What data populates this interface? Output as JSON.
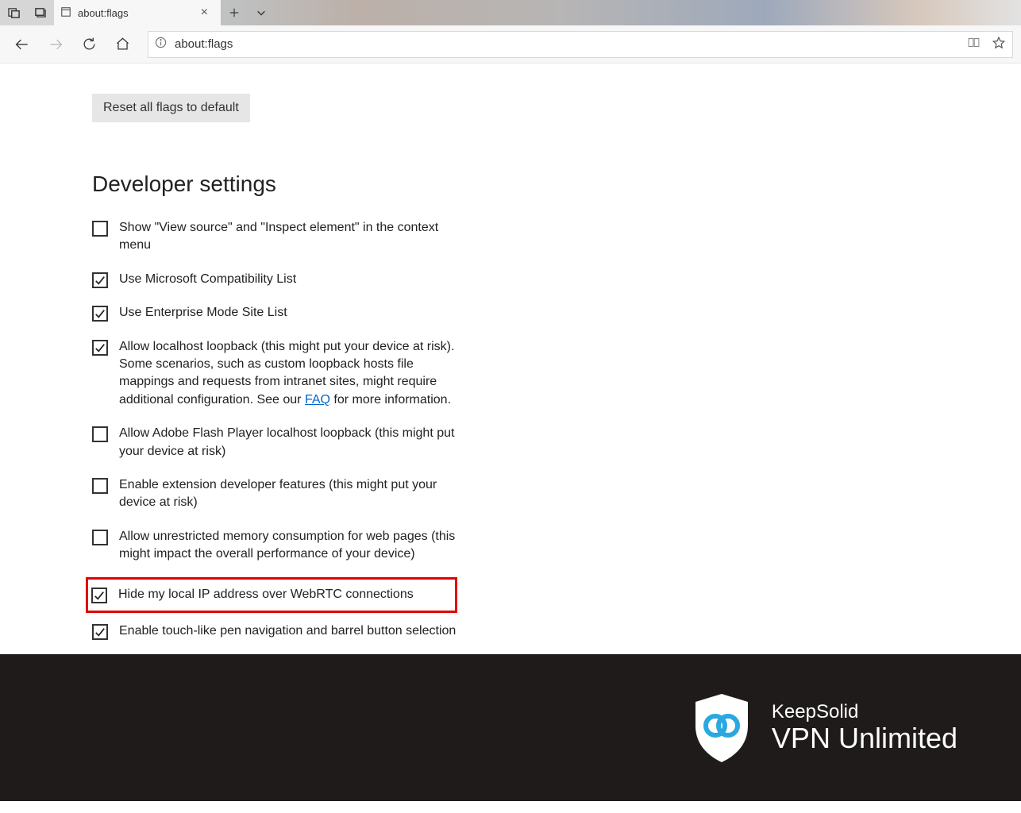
{
  "tab": {
    "title": "about:flags"
  },
  "address": {
    "url": "about:flags"
  },
  "reset_button": "Reset all flags to default",
  "section_title": "Developer settings",
  "faq_link_text": "FAQ",
  "options": [
    {
      "label": "Show \"View source\" and \"Inspect element\" in the context menu",
      "checked": false
    },
    {
      "label": "Use Microsoft Compatibility List",
      "checked": true
    },
    {
      "label": "Use Enterprise Mode Site List",
      "checked": true
    },
    {
      "label_pre": "Allow localhost loopback (this might put your device at risk). Some scenarios, such as custom loopback hosts file mappings and requests from intranet sites, might require additional configuration. See our ",
      "label_post": " for more information.",
      "checked": true,
      "has_link": true
    },
    {
      "label": "Allow Adobe Flash Player localhost loopback (this might put your device at risk)",
      "checked": false
    },
    {
      "label": "Enable extension developer features (this might put your device at risk)",
      "checked": false
    },
    {
      "label": "Allow unrestricted memory consumption for web pages (this might impact the overall performance of your device)",
      "checked": false
    },
    {
      "label": "Hide my local IP address over WebRTC connections",
      "checked": true,
      "highlighted": true
    },
    {
      "label": "Enable touch-like pen navigation and barrel button selection",
      "checked": true
    }
  ],
  "footer": {
    "brand_top": "KeepSolid",
    "brand_bottom": "VPN Unlimited"
  }
}
